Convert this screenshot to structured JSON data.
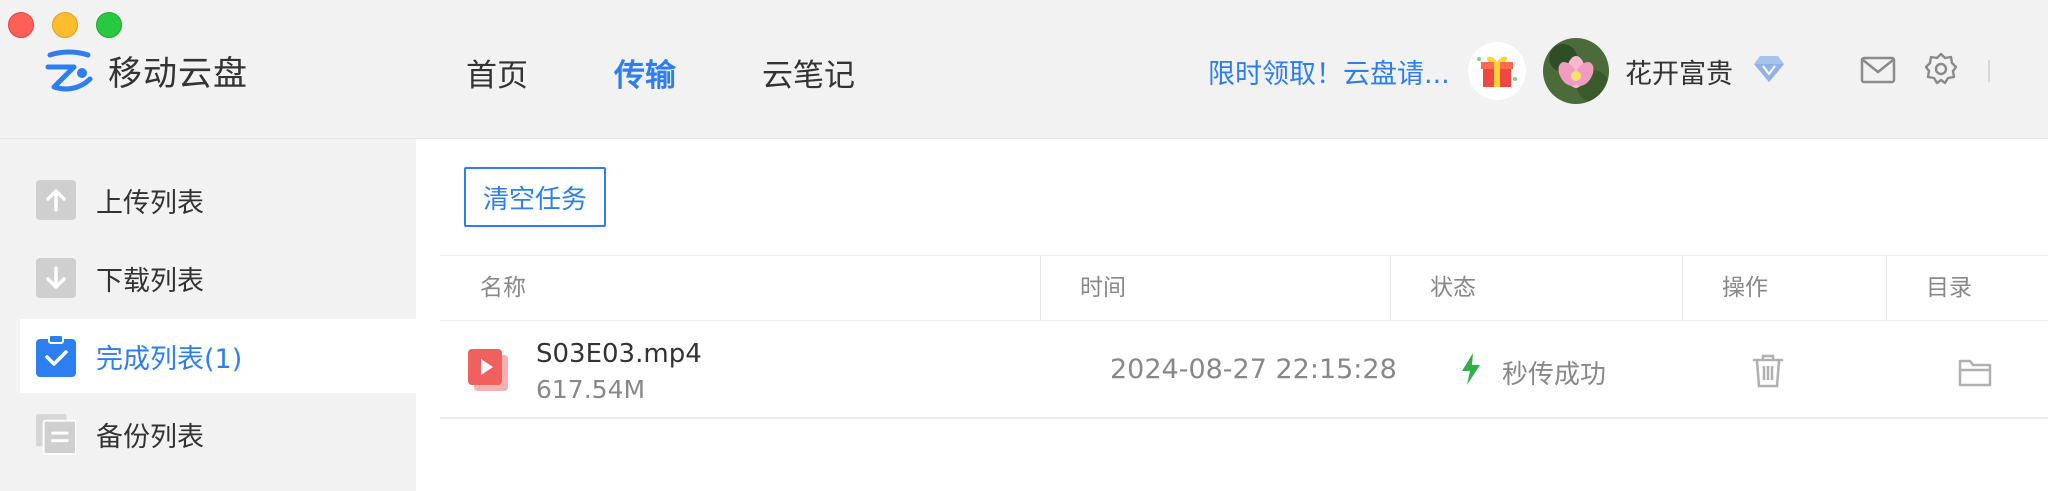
{
  "app": {
    "name": "移动云盘"
  },
  "nav": {
    "items": [
      {
        "label": "首页"
      },
      {
        "label": "传输"
      },
      {
        "label": "云笔记"
      }
    ]
  },
  "header": {
    "promo": "限时领取！云盘请...",
    "username": "花开富贵"
  },
  "sidebar": {
    "items": [
      {
        "label": "上传列表"
      },
      {
        "label": "下载列表"
      },
      {
        "label": "完成列表(1)"
      },
      {
        "label": "备份列表"
      }
    ]
  },
  "toolbar": {
    "clear_label": "清空任务"
  },
  "table": {
    "columns": [
      "名称",
      "时间",
      "状态",
      "操作",
      "目录"
    ],
    "rows": [
      {
        "name": "S03E03.mp4",
        "size": "617.54M",
        "time": "2024-08-27 22:15:28",
        "status": "秒传成功"
      }
    ]
  },
  "colors": {
    "accent": "#2d7ef1",
    "status_green": "#2fb04c",
    "file_red": "#f0605f"
  }
}
